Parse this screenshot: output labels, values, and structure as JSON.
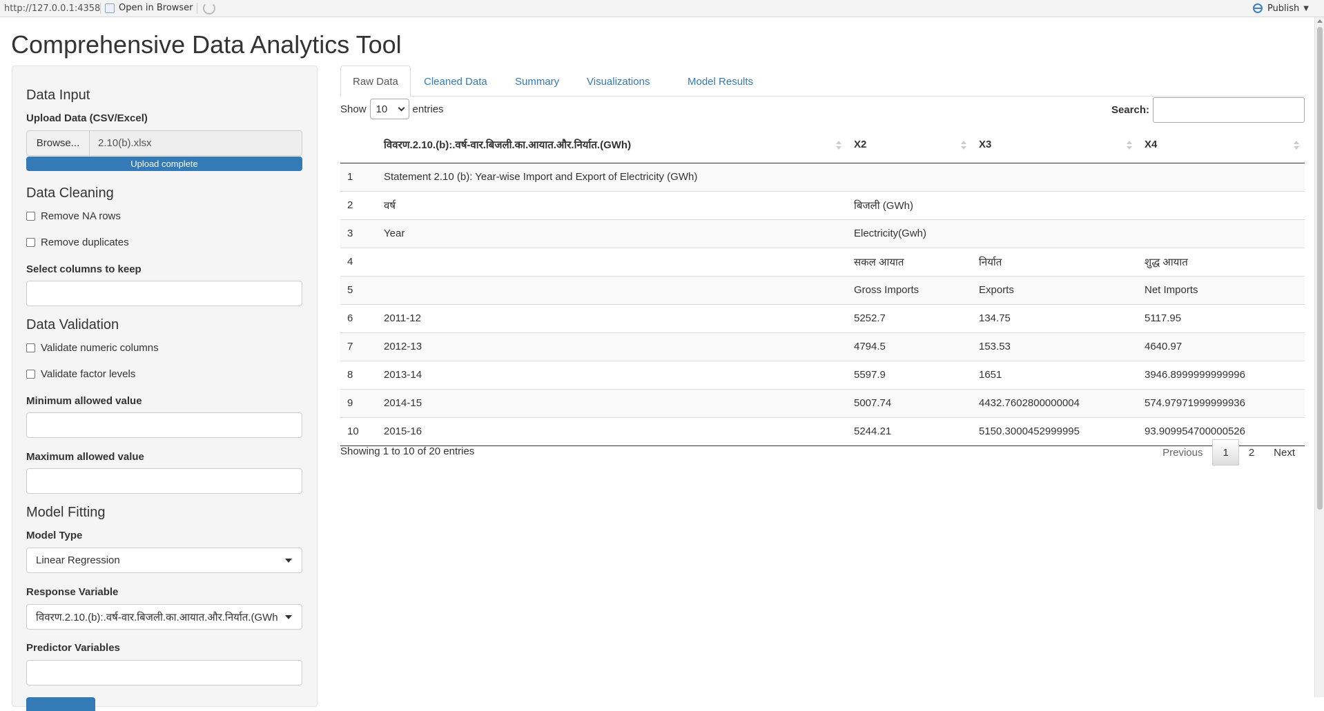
{
  "viewer": {
    "url": "http://127.0.0.1:4358",
    "open_in_browser": "Open in Browser",
    "publish": "Publish"
  },
  "app": {
    "title": "Comprehensive Data Analytics Tool"
  },
  "sidebar": {
    "data_input": {
      "title": "Data Input",
      "upload_label": "Upload Data (CSV/Excel)",
      "browse_label": "Browse...",
      "filename": "2.10(b).xlsx",
      "progress_text": "Upload complete",
      "progress": 1.0
    },
    "data_cleaning": {
      "title": "Data Cleaning",
      "remove_na": "Remove NA rows",
      "remove_dupes": "Remove duplicates",
      "select_cols_label": "Select columns to keep"
    },
    "data_validation": {
      "title": "Data Validation",
      "validate_numeric": "Validate numeric columns",
      "validate_factor": "Validate factor levels",
      "min_label": "Minimum allowed value",
      "max_label": "Maximum allowed value"
    },
    "model_fitting": {
      "title": "Model Fitting",
      "model_type_label": "Model Type",
      "model_type_value": "Linear Regression",
      "response_label": "Response Variable",
      "response_value": "विवरण.2.10.(b):.वर्ष-वार.बिजली.का.आयात.और.निर्यात.(GWh)",
      "predictor_label": "Predictor Variables"
    }
  },
  "tabs": [
    "Raw Data",
    "Cleaned Data",
    "Summary",
    "Visualizations",
    "Model Results"
  ],
  "table_controls": {
    "show": "Show",
    "entries_value": "10",
    "entries": "entries",
    "search_label": "Search:"
  },
  "table": {
    "columns": [
      "",
      "विवरण.2.10.(b):.वर्ष-वार.बिजली.का.आयात.और.निर्यात.(GWh)",
      "X2",
      "X3",
      "X4"
    ],
    "rows": [
      [
        "1",
        "Statement 2.10 (b): Year-wise Import and Export of Electricity (GWh)",
        "",
        "",
        ""
      ],
      [
        "2",
        "वर्ष",
        "बिजली (GWh)",
        "",
        ""
      ],
      [
        "3",
        "Year",
        "Electricity(Gwh)",
        "",
        ""
      ],
      [
        "4",
        "",
        "सकल आयात",
        "निर्यात",
        "शुद्ध आयात"
      ],
      [
        "5",
        "",
        "Gross Imports",
        "Exports",
        "Net Imports"
      ],
      [
        "6",
        "2011-12",
        "5252.7",
        "134.75",
        "5117.95"
      ],
      [
        "7",
        "2012-13",
        "4794.5",
        "153.53",
        "4640.97"
      ],
      [
        "8",
        "2013-14",
        "5597.9",
        "1651",
        "3946.8999999999996"
      ],
      [
        "9",
        "2014-15",
        "5007.74",
        "4432.7602800000004",
        "574.97971999999936"
      ],
      [
        "10",
        "2015-16",
        "5244.21",
        "5150.3000452999995",
        "93.909954700000526"
      ]
    ],
    "info": "Showing 1 to 10 of 20 entries"
  },
  "pagination": {
    "previous": "Previous",
    "pages": [
      "1",
      "2"
    ],
    "next": "Next"
  }
}
